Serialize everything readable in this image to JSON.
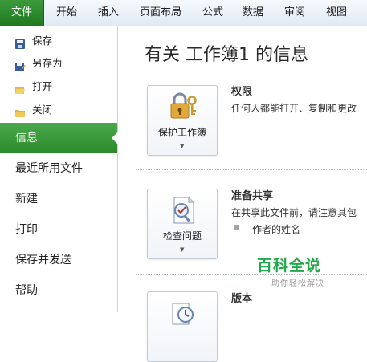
{
  "ribbon": {
    "tabs": [
      "文件",
      "开始",
      "插入",
      "页面布局",
      "公式",
      "数据",
      "审阅",
      "视图"
    ]
  },
  "sidebar": {
    "top_items": [
      {
        "label": "保存",
        "icon": "save-icon"
      },
      {
        "label": "另存为",
        "icon": "save-as-icon"
      },
      {
        "label": "打开",
        "icon": "open-folder-icon"
      },
      {
        "label": "关闭",
        "icon": "close-folder-icon"
      }
    ],
    "nav_items": [
      "信息",
      "最近所用文件",
      "新建",
      "打印",
      "保存并发送",
      "帮助"
    ],
    "active_index": 0
  },
  "main": {
    "title": "有关 工作簿1 的信息",
    "sections": [
      {
        "button_label": "保护工作簿",
        "button_icon": "lock-key-icon",
        "heading": "权限",
        "desc": "任何人都能打开、复制和更改"
      },
      {
        "button_label": "检查问题",
        "button_icon": "checklist-icon",
        "heading": "准备共享",
        "desc": "在共享此文件前，请注意其包",
        "bullet": "作者的姓名"
      },
      {
        "button_label": "",
        "button_icon": "versions-icon",
        "heading": "版本",
        "desc": ""
      }
    ]
  },
  "watermark": {
    "line1": "百科全说",
    "line2": "助你轻松解决"
  },
  "colors": {
    "file_tab": "#2b8a2b",
    "active_nav": "#3a9a3a",
    "watermark": "#21a84a"
  }
}
